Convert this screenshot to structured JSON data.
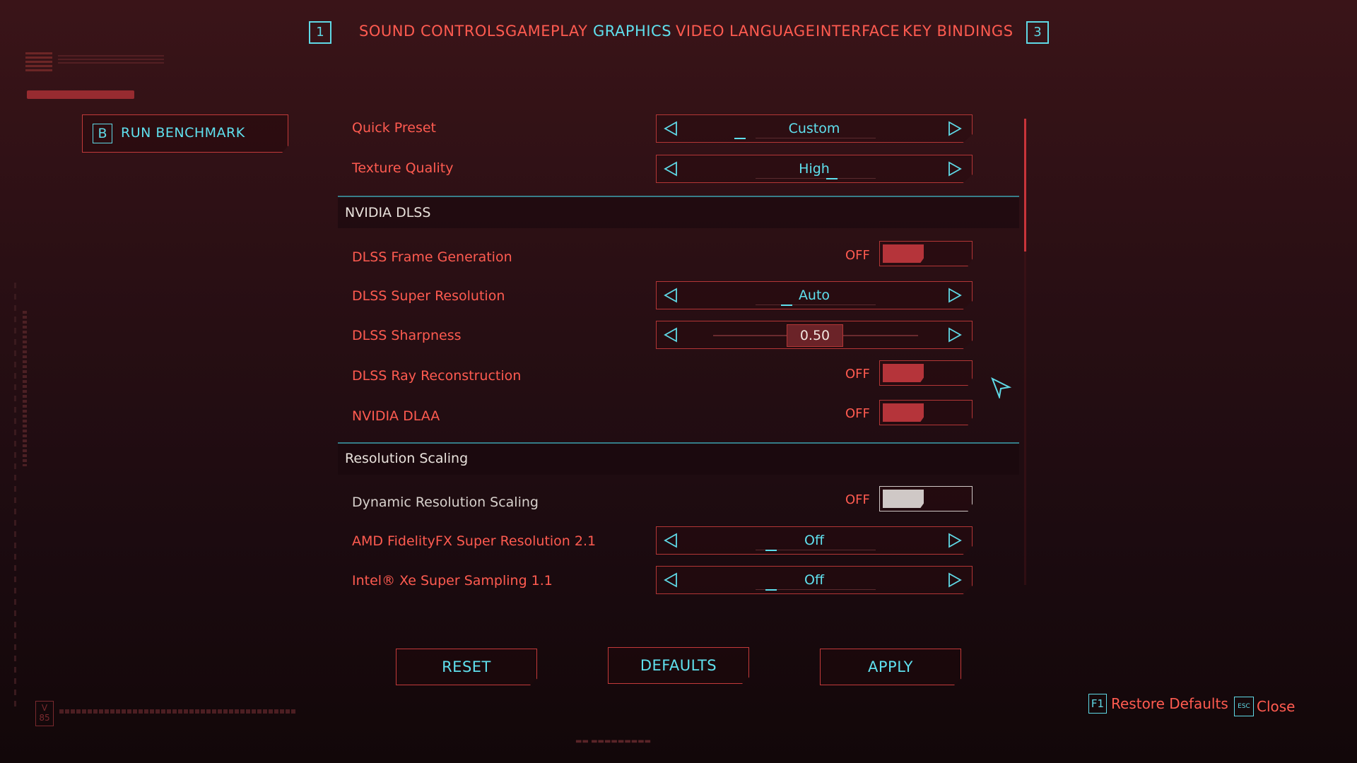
{
  "nav": {
    "prev_key": "1",
    "next_key": "3",
    "tabs": [
      {
        "label": "SOUND"
      },
      {
        "label": "CONTROLS"
      },
      {
        "label": "GAMEPLAY"
      },
      {
        "label": "GRAPHICS"
      },
      {
        "label": "VIDEO"
      },
      {
        "label": "LANGUAGE"
      },
      {
        "label": "INTERFACE"
      },
      {
        "label": "KEY BINDINGS"
      }
    ],
    "active_tab": "GRAPHICS"
  },
  "benchmark": {
    "key": "B",
    "label": "RUN BENCHMARK"
  },
  "settings": {
    "quick_preset": {
      "label": "Quick Preset",
      "value": "Custom"
    },
    "texture_quality": {
      "label": "Texture Quality",
      "value": "High"
    },
    "section_dlss": {
      "title": "NVIDIA DLSS"
    },
    "dlss_frame_generation": {
      "label": "DLSS Frame Generation",
      "state": "OFF"
    },
    "dlss_super_resolution": {
      "label": "DLSS Super Resolution",
      "value": "Auto"
    },
    "dlss_sharpness": {
      "label": "DLSS Sharpness",
      "value": "0.50"
    },
    "dlss_ray_reconstruction": {
      "label": "DLSS Ray Reconstruction",
      "state": "OFF"
    },
    "nvidia_dlaa": {
      "label": "NVIDIA DLAA",
      "state": "OFF"
    },
    "section_scaling": {
      "title": "Resolution Scaling"
    },
    "dynamic_resolution_scaling": {
      "label": "Dynamic Resolution Scaling",
      "state": "OFF"
    },
    "amd_fsr": {
      "label": "AMD FidelityFX Super Resolution 2.1",
      "value": "Off"
    },
    "intel_xess": {
      "label": "Intel® Xe Super Sampling 1.1",
      "value": "Off"
    }
  },
  "buttons": {
    "reset": "RESET",
    "defaults": "DEFAULTS",
    "apply": "APPLY"
  },
  "hints": {
    "restore_key": "F1",
    "restore_label": "Restore Defaults",
    "close_key": "ESC",
    "close_label": "Close"
  },
  "badge": {
    "text": "V 85"
  },
  "colors": {
    "accent_red": "#ff5b50",
    "accent_cyan": "#5fe0ee",
    "toggle_off": "#b5343a"
  }
}
